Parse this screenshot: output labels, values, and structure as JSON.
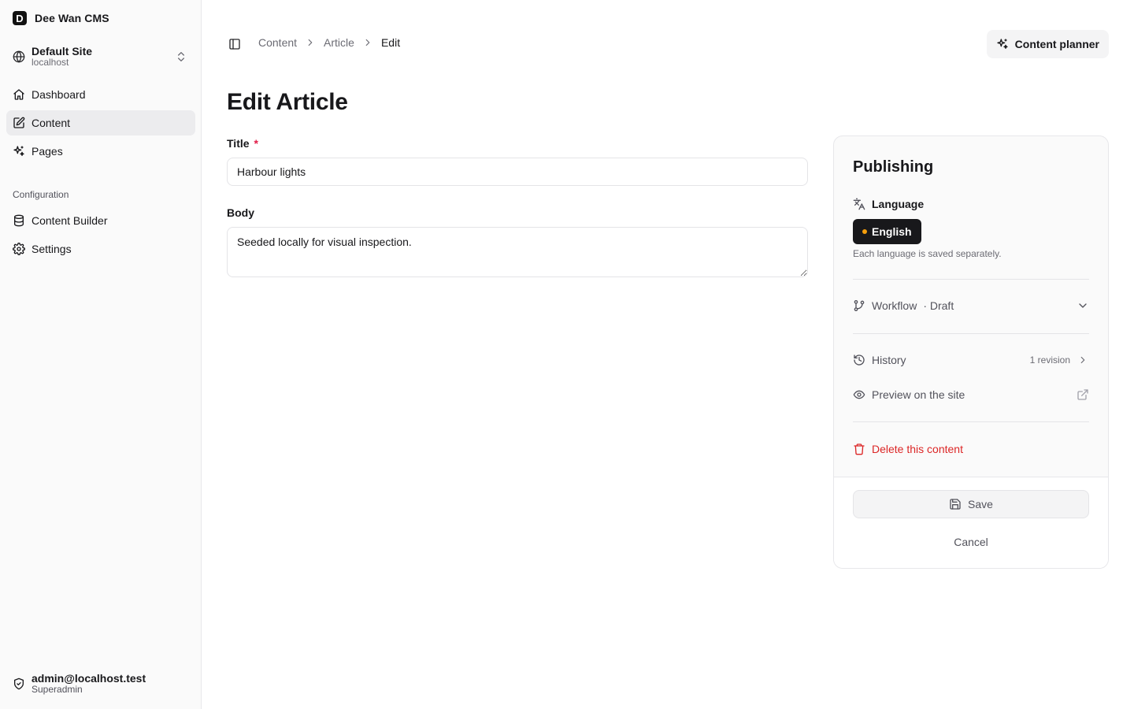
{
  "app": {
    "name": "Dee Wan CMS",
    "logo_letter": "D"
  },
  "site": {
    "name": "Default Site",
    "host": "localhost"
  },
  "nav": {
    "main": [
      {
        "label": "Dashboard",
        "icon": "home-icon"
      },
      {
        "label": "Content",
        "icon": "edit-icon",
        "active": true
      },
      {
        "label": "Pages",
        "icon": "sparkles-icon"
      }
    ],
    "config_label": "Configuration",
    "config": [
      {
        "label": "Content Builder",
        "icon": "database-icon"
      },
      {
        "label": "Settings",
        "icon": "gear-icon"
      }
    ]
  },
  "user": {
    "email": "admin@localhost.test",
    "role": "Superadmin"
  },
  "breadcrumb": {
    "items": [
      "Content",
      "Article",
      "Edit"
    ]
  },
  "header": {
    "planner_label": "Content planner"
  },
  "page": {
    "title": "Edit Article"
  },
  "form": {
    "title_label": "Title",
    "title_required": "*",
    "title_value": "Harbour lights",
    "body_label": "Body",
    "body_value": "Seeded locally for visual inspection."
  },
  "publishing": {
    "title": "Publishing",
    "language_label": "Language",
    "language_value": "English",
    "language_note": "Each language is saved separately.",
    "workflow_label": "Workflow",
    "workflow_status": "· Draft",
    "history_label": "History",
    "history_meta": "1 revision",
    "preview_label": "Preview on the site",
    "delete_label": "Delete this content",
    "save_label": "Save",
    "cancel_label": "Cancel"
  },
  "colors": {
    "accent": "#18181b",
    "danger": "#dc2626",
    "language_dot": "#f59e0b",
    "required": "#e11d48"
  }
}
